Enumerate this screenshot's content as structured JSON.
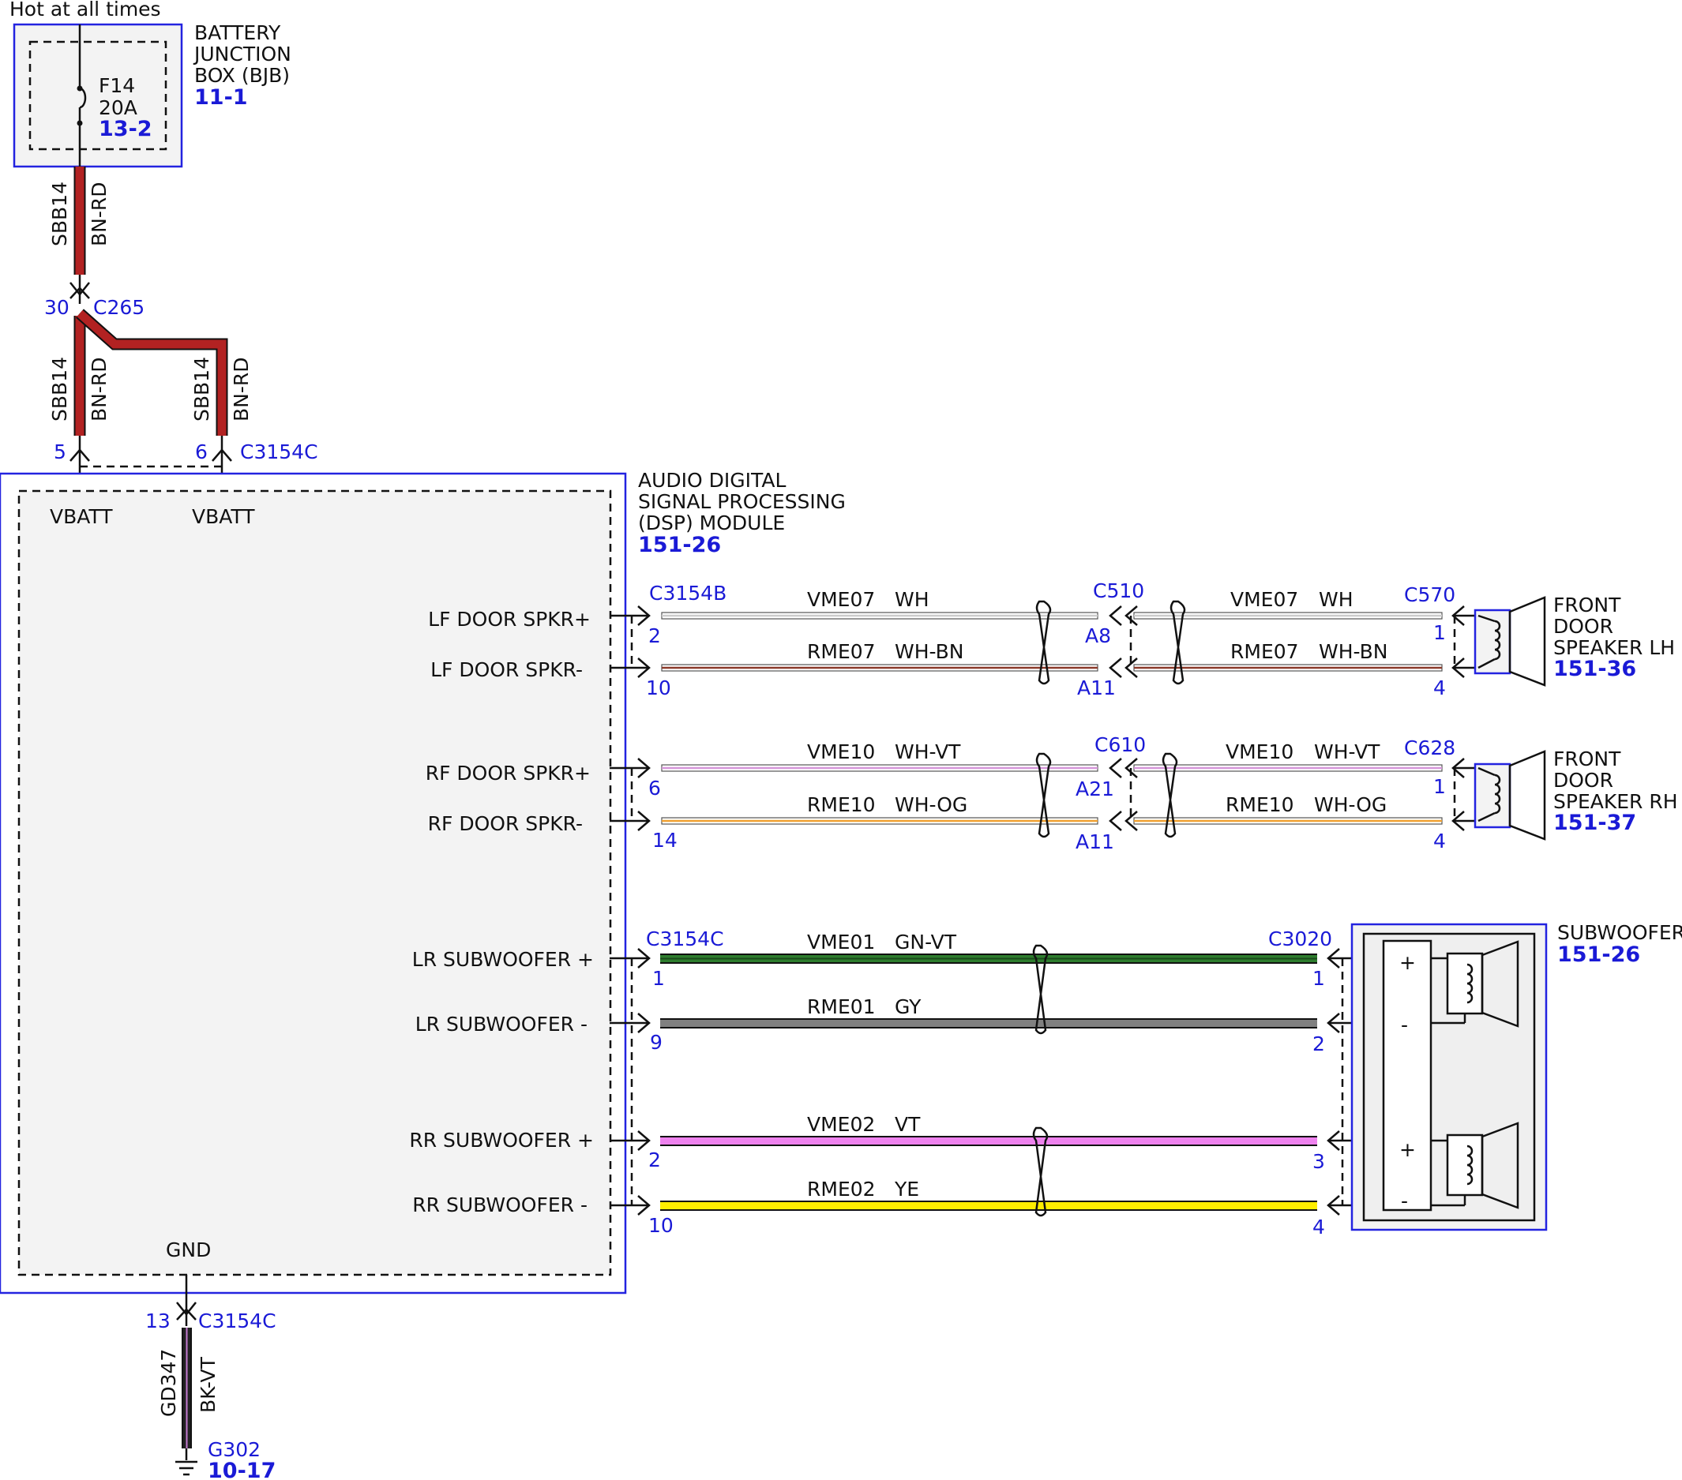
{
  "colors": {
    "BN-RD": "#b22222",
    "WH": "#cccccc",
    "WH-BN": "#8b3a2a",
    "WH-VT": "#d596d9",
    "WH-OG": "#f0a030",
    "GN-VT": "#2e7d2e",
    "GY": "#808080",
    "VT": "#ee82ee",
    "YE": "#ffee00",
    "BK-VT": "#222222",
    "reference": "#1a1ad6"
  },
  "power": {
    "header": "Hot at all times",
    "bjb_line1": "BATTERY",
    "bjb_line2": "JUNCTION",
    "bjb_line3": "BOX (BJB)",
    "bjb_ref": "11-1",
    "fuse_name": "F14",
    "fuse_rating": "20A",
    "fuse_ref": "13-2",
    "wire_top_circuit": "SBB14",
    "wire_top_color": "BN-RD",
    "c265_pin": "30",
    "c265_name": "C265",
    "wire_left_circuit": "SBB14",
    "wire_left_color": "BN-RD",
    "wire_right_circuit": "SBB14",
    "wire_right_color": "BN-RD",
    "pin_left": "5",
    "pin_right": "6",
    "c3154c_name": "C3154C"
  },
  "dsp": {
    "title_line1": "AUDIO DIGITAL",
    "title_line2": "SIGNAL PROCESSING",
    "title_line3": "(DSP) MODULE",
    "ref": "151-26",
    "vbatt_left": "VBATT",
    "vbatt_right": "VBATT",
    "gnd": "GND",
    "ports": [
      "LF DOOR SPKR+",
      "LF DOOR SPKR-",
      "RF DOOR SPKR+",
      "RF DOOR SPKR-",
      "LR SUBWOOFER +",
      "LR SUBWOOFER -",
      "RR SUBWOOFER +",
      "RR SUBWOOFER -"
    ]
  },
  "connectors": {
    "c3154b": "C3154B",
    "c510": "C510",
    "c570": "C570",
    "c610": "C610",
    "c628": "C628",
    "c3154c_sub": "C3154C",
    "c3020": "C3020"
  },
  "front_lh": {
    "label_line1": "FRONT",
    "label_line2": "DOOR",
    "label_line3": "SPEAKER LH",
    "ref": "151-36",
    "wires": [
      {
        "circuit_a": "VME07",
        "color_a": "WH",
        "circuit_b": "VME07",
        "color_b": "WH",
        "pin_dsp": "2",
        "pin_mid": "A8",
        "pin_spk": "1"
      },
      {
        "circuit_a": "RME07",
        "color_a": "WH-BN",
        "circuit_b": "RME07",
        "color_b": "WH-BN",
        "pin_dsp": "10",
        "pin_mid": "A11",
        "pin_spk": "4"
      }
    ]
  },
  "front_rh": {
    "label_line1": "FRONT",
    "label_line2": "DOOR",
    "label_line3": "SPEAKER RH",
    "ref": "151-37",
    "wires": [
      {
        "circuit_a": "VME10",
        "color_a": "WH-VT",
        "circuit_b": "VME10",
        "color_b": "WH-VT",
        "pin_dsp": "6",
        "pin_mid": "A21",
        "pin_spk": "1"
      },
      {
        "circuit_a": "RME10",
        "color_a": "WH-OG",
        "circuit_b": "RME10",
        "color_b": "WH-OG",
        "pin_dsp": "14",
        "pin_mid": "A11",
        "pin_spk": "4"
      }
    ]
  },
  "subwoofer": {
    "label": "SUBWOOFER",
    "ref": "151-26",
    "plus_top": "+",
    "minus_top": "-",
    "plus_bottom": "+",
    "minus_bottom": "-",
    "wires": [
      {
        "circuit": "VME01",
        "color": "GN-VT",
        "pin_dsp": "1",
        "pin_sub": "1"
      },
      {
        "circuit": "RME01",
        "color": "GY",
        "pin_dsp": "9",
        "pin_sub": "2"
      },
      {
        "circuit": "VME02",
        "color": "VT",
        "pin_dsp": "2",
        "pin_sub": "3"
      },
      {
        "circuit": "RME02",
        "color": "YE",
        "pin_dsp": "10",
        "pin_sub": "4"
      }
    ]
  },
  "ground": {
    "pin": "13",
    "connector": "C3154C",
    "circuit": "GD347",
    "color": "BK-VT",
    "point": "G302",
    "ref": "10-17"
  }
}
